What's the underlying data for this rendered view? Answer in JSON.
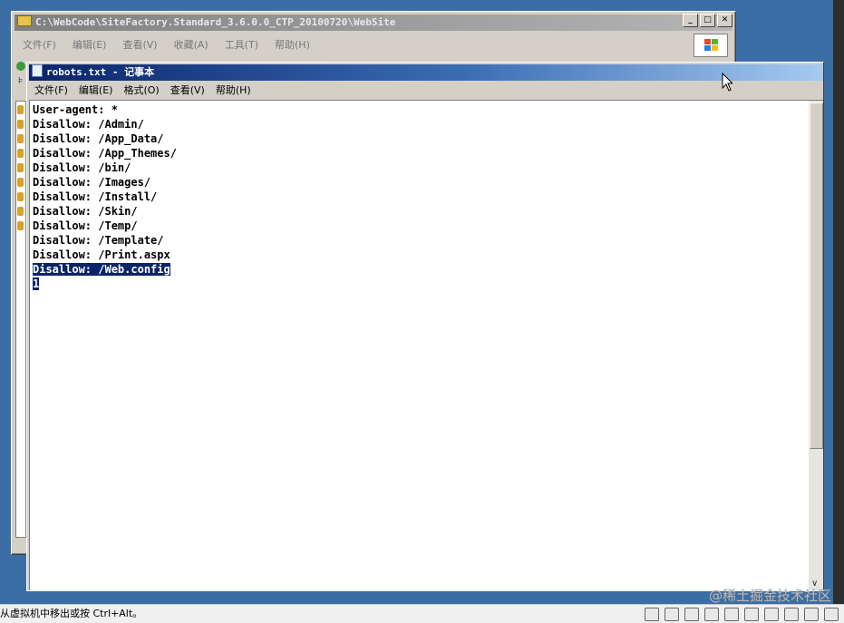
{
  "explorer": {
    "title": "C:\\WebCode\\SiteFactory.Standard_3.6.0.0_CTP_20100720\\WebSite",
    "menu": [
      "文件(F)",
      "编辑(E)",
      "查看(V)",
      "收藏(A)",
      "工具(T)",
      "帮助(H)"
    ]
  },
  "notepad": {
    "title": "robots.txt - 记事本",
    "menu": [
      "文件(F)",
      "编辑(E)",
      "格式(O)",
      "查看(V)",
      "帮助(H)"
    ],
    "lines": [
      "User-agent: *",
      "Disallow: /Admin/",
      "Disallow: /App_Data/",
      "Disallow: /App_Themes/",
      "Disallow: /bin/",
      "Disallow: /Images/",
      "Disallow: /Install/",
      "Disallow: /Skin/",
      "Disallow: /Temp/",
      "Disallow: /Template/",
      "Disallow: /Print.aspx"
    ],
    "selected_lines": [
      "Disallow: /Web.config",
      "1"
    ]
  },
  "statusbar": {
    "hint": "从虚拟机中移出或按 Ctrl+Alt。"
  },
  "watermark": "@稀土掘金技术社区",
  "colors": {
    "desktop": "#3a6ea5",
    "titlebar_active": "#0a246a",
    "selection": "#0a246a"
  }
}
